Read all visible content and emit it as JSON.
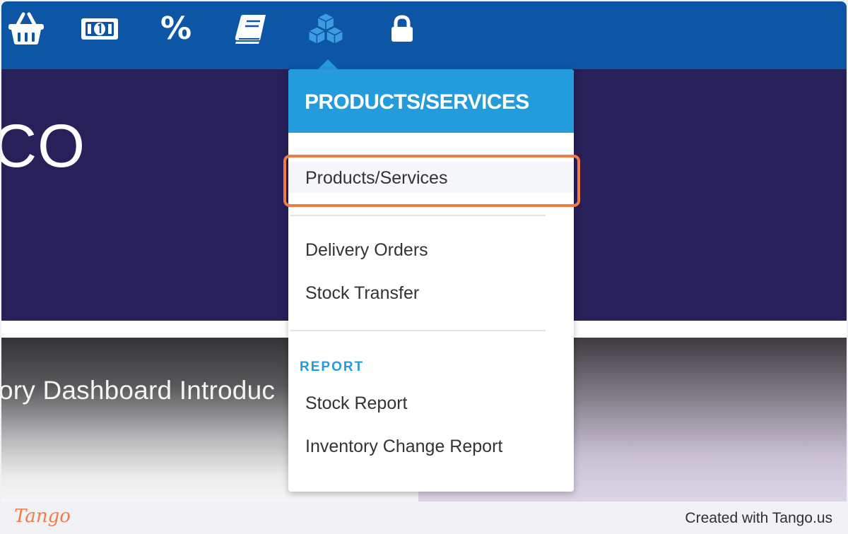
{
  "nav": {
    "icons": [
      {
        "name": "basket-icon"
      },
      {
        "name": "money-icon"
      },
      {
        "name": "percent-icon",
        "glyph": "%"
      },
      {
        "name": "book-icon"
      },
      {
        "name": "cubes-icon"
      },
      {
        "name": "lock-icon"
      }
    ],
    "background": "#0d56a6",
    "active_icon_color": "#3d9be0"
  },
  "hero": {
    "text": "CO",
    "background": "#272059"
  },
  "video": {
    "title": "ory Dashboard Introduc"
  },
  "dropdown": {
    "header": "PRODUCTS/SERVICES",
    "header_color": "#249cdb",
    "items": [
      {
        "label": "Products/Services",
        "highlighted": true
      },
      {
        "label": "Delivery Orders"
      },
      {
        "label": "Stock Transfer"
      }
    ],
    "report_section": {
      "label": "REPORT",
      "items": [
        {
          "label": "Stock Report"
        },
        {
          "label": "Inventory Change Report"
        }
      ]
    },
    "highlight_color": "#f27a43"
  },
  "footer": {
    "logo": "Tango",
    "text": "Created with Tango.us",
    "logo_color": "#f07c4a"
  }
}
